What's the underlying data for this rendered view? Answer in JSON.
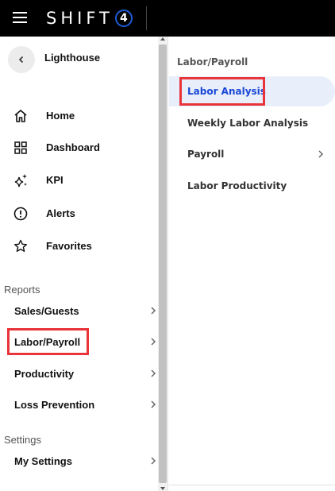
{
  "header": {
    "brand_text": "SHIFT",
    "brand_badge": "4"
  },
  "sidebar": {
    "app_name": "Lighthouse",
    "nav": [
      {
        "label": "Home",
        "icon": "home-icon"
      },
      {
        "label": "Dashboard",
        "icon": "dashboard-grid-icon"
      },
      {
        "label": "KPI",
        "icon": "sparkle-icon"
      },
      {
        "label": "Alerts",
        "icon": "alert-circle-icon"
      },
      {
        "label": "Favorites",
        "icon": "star-icon"
      }
    ],
    "reports_title": "Reports",
    "reports": [
      {
        "label": "Sales/Guests"
      },
      {
        "label": "Labor/Payroll"
      },
      {
        "label": "Productivity"
      },
      {
        "label": "Loss Prevention"
      }
    ],
    "settings_title": "Settings",
    "settings": [
      {
        "label": "My Settings"
      }
    ]
  },
  "panel": {
    "title": "Labor/Payroll",
    "items": [
      {
        "label": "Labor Analysis"
      },
      {
        "label": "Weekly Labor Analysis"
      },
      {
        "label": "Payroll"
      },
      {
        "label": "Labor Productivity"
      }
    ]
  },
  "colors": {
    "topbar": "#000000",
    "accent_blue": "#1a47d6",
    "active_bg": "#e8effb",
    "highlight_red": "#e8343a"
  }
}
